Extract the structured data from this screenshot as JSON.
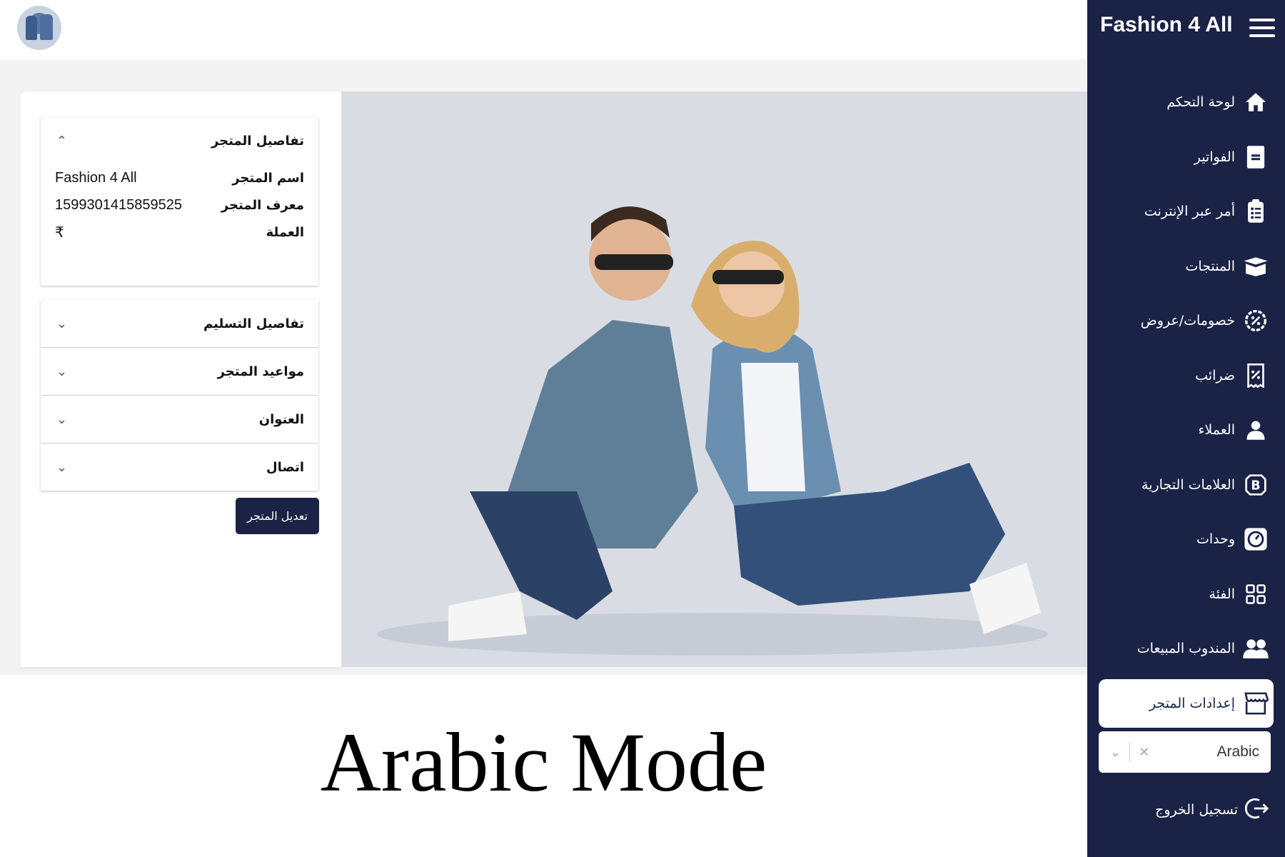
{
  "sidebar": {
    "brand": "Fashion 4 All",
    "items": [
      {
        "label": "لوحة التحكم",
        "icon": "home-icon"
      },
      {
        "label": "الفواتير",
        "icon": "invoice-icon"
      },
      {
        "label": "أمر عبر الإنترنت",
        "icon": "clipboard-icon"
      },
      {
        "label": "المنتجات",
        "icon": "box-icon"
      },
      {
        "label": "خصومات/عروض",
        "icon": "discount-icon"
      },
      {
        "label": "ضرائب",
        "icon": "tax-receipt-icon"
      },
      {
        "label": "العملاء",
        "icon": "user-icon"
      },
      {
        "label": "العلامات التجارية",
        "icon": "brand-icon"
      },
      {
        "label": "وحدات",
        "icon": "units-icon"
      },
      {
        "label": "الفئة",
        "icon": "category-grid-icon"
      },
      {
        "label": "المندوب المبيعات",
        "icon": "users-icon"
      },
      {
        "label": "إعدادات المتجر",
        "icon": "store-icon",
        "active": true
      }
    ],
    "language": {
      "value": "Arabic"
    },
    "logout_label": "تسجيل الخروج"
  },
  "store_details": {
    "title": "تفاصيل المتجر",
    "rows": [
      {
        "key": "اسم المتجر",
        "value": "Fashion 4 All"
      },
      {
        "key": "معرف المتجر",
        "value": "1599301415859525"
      },
      {
        "key": "العملة",
        "value": "₹"
      }
    ]
  },
  "sections": [
    {
      "title": "تفاصيل التسليم"
    },
    {
      "title": "مواعيد المتجر"
    },
    {
      "title": "العنوان"
    },
    {
      "title": "اتصال"
    }
  ],
  "edit_button": "تعديل المتجر",
  "caption": "Arabic Mode",
  "colors": {
    "sidebar_bg": "#1a2346",
    "accent": "#1a2346",
    "photo_bg": "#d9dde3"
  }
}
